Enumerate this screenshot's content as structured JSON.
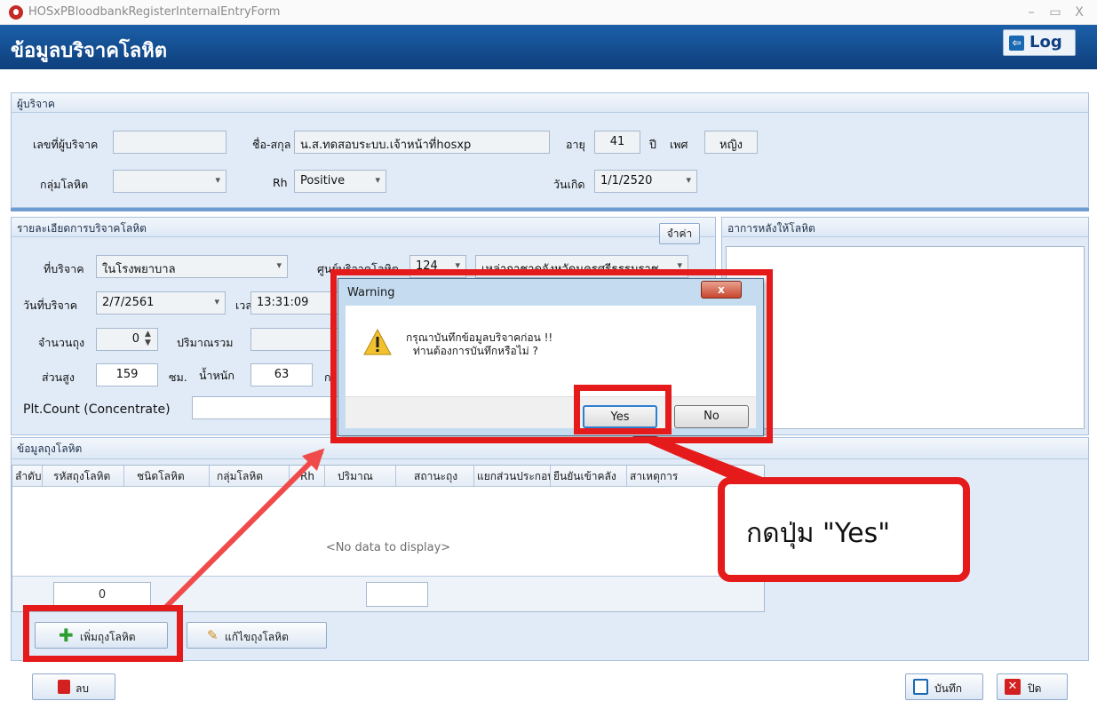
{
  "window": {
    "title": "HOSxPBloodbankRegisterInternalEntryForm",
    "minimize": "–",
    "maximize": "▭",
    "close": "X"
  },
  "header": {
    "title": "ข้อมูลบริจาคโลหิต",
    "log_label": "Log",
    "log_icon_glyph": "⇦"
  },
  "donor": {
    "panel_title": "ผู้บริจาค",
    "donor_no_label": "เลขที่ผู้บริจาค",
    "donor_no_value": "",
    "name_label": "ชื่อ-สกุล",
    "name_value": "น.ส.ทดสอบระบบ.เจ้าหน้าที่hosxp",
    "age_label": "อายุ",
    "age_value": "41",
    "year_label": "ปี",
    "sex_label": "เพศ",
    "sex_value": "หญิง",
    "blood_group_label": "กลุ่มโลหิต",
    "blood_group_value": "",
    "rh_label": "Rh",
    "rh_value": "Positive",
    "birthdate_label": "วันเกิด",
    "birthdate_value": "1/1/2520"
  },
  "donation": {
    "panel_title": "รายละเอียดการบริจาคโลหิต",
    "remember_button": "จำค่า",
    "place_label": "ที่บริจาค",
    "place_value": "ในโรงพยาบาล",
    "center_label": "ศูนย์บริจาคโลหิต",
    "center_code": "124",
    "center_name": "เหล่ากาชาดจังหวัดนครศรีธรรมราช",
    "date_label": "วันที่บริจาค",
    "date_value": "2/7/2561",
    "time_label": "เวลา",
    "time_value": "13:31:09",
    "bag_count_label": "จำนวนถุง",
    "bag_count_value": "0",
    "total_volume_label": "ปริมาณรวม",
    "height_label": "ส่วนสูง",
    "height_value": "159",
    "height_unit": "ซม.",
    "weight_label": "น้ำหนัก",
    "weight_value": "63",
    "weight_unit_partial": "ก",
    "plt_label": "Plt.Count (Concentrate)"
  },
  "after_symptoms": {
    "panel_title": "อาการหลังให้โลหิต"
  },
  "bags": {
    "panel_title": "ข้อมูลถุงโลหิต",
    "columns": [
      "ลำดับ",
      "รหัสถุงโลหิต",
      "ชนิดโลหิต",
      "กลุ่มโลหิต",
      "Rh",
      "ปริมาณ",
      "สถานะถุง",
      "แยกส่วนประกอบ",
      "ยืนยันเข้าคลัง",
      "สาเหตุการ"
    ],
    "empty_text": "<No data to display>",
    "footer_count": "0",
    "add_button": "เพิ่มถุงโลหิต",
    "edit_button": "แก้ไขถุงโลหิต"
  },
  "bottom": {
    "delete_button": "ลบ",
    "save_button": "บันทึก",
    "close_button": "ปิด"
  },
  "dialog": {
    "title": "Warning",
    "close_glyph": "x",
    "message_line1": "กรุณาบันทึกข้อมูลบริจาคก่อน !!",
    "message_line2": "ท่านต้องการบันทึกหรือไม่ ?",
    "yes_button": "Yes",
    "no_button": "No"
  },
  "annotation": {
    "callout_text": "กดปุ่ม \"Yes\"",
    "highlight_color": "#e51a1a",
    "arrow_color": "#f04a4a"
  }
}
